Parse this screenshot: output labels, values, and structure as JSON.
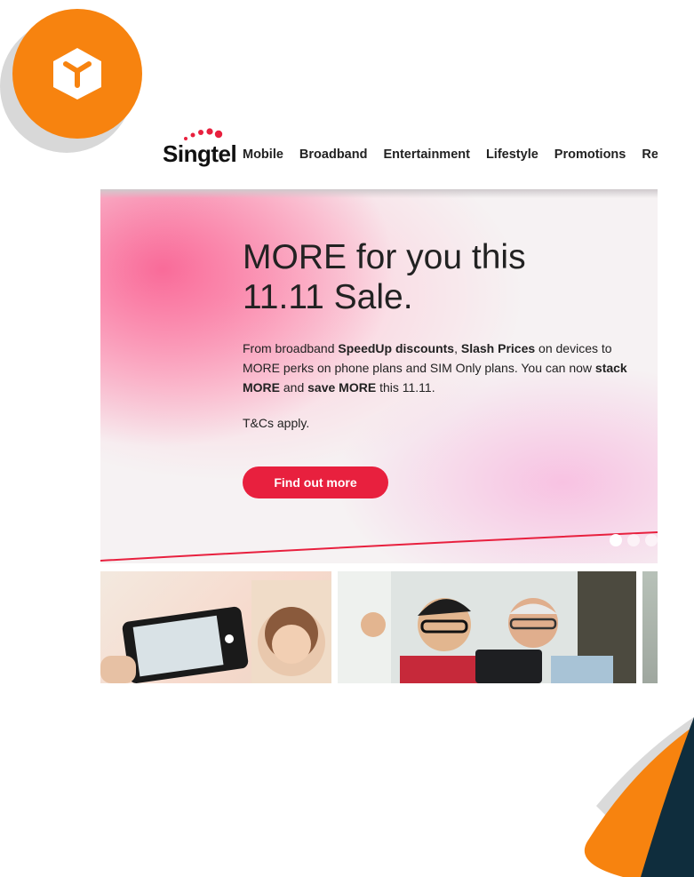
{
  "brand": {
    "name": "Singtel",
    "red": "#e8203e",
    "orange": "#f7830f",
    "navy": "#0f2d3d"
  },
  "nav": {
    "items": [
      "Mobile",
      "Broadband",
      "Entertainment",
      "Lifestyle",
      "Promotions",
      "Rew"
    ]
  },
  "hero": {
    "title_line1": "MORE for you this",
    "title_line2": "11.11 Sale.",
    "body_1": "From broadband ",
    "body_2": "SpeedUp discounts",
    "body_3": ", ",
    "body_4": "Slash Prices",
    "body_5": " on devices to MORE perks on phone plans and SIM Only plans. You can now ",
    "body_6": "stack MORE",
    "body_7": " and ",
    "body_8": "save MORE",
    "body_9": " this 11.11.",
    "terms": "T&Cs apply.",
    "cta": "Find out more",
    "carousel_slides": 3,
    "active_slide": 1
  },
  "thumbnails": [
    {
      "icon": "phone-camera-photo"
    },
    {
      "icon": "video-call-photo"
    },
    {
      "icon": "partial-photo"
    }
  ]
}
